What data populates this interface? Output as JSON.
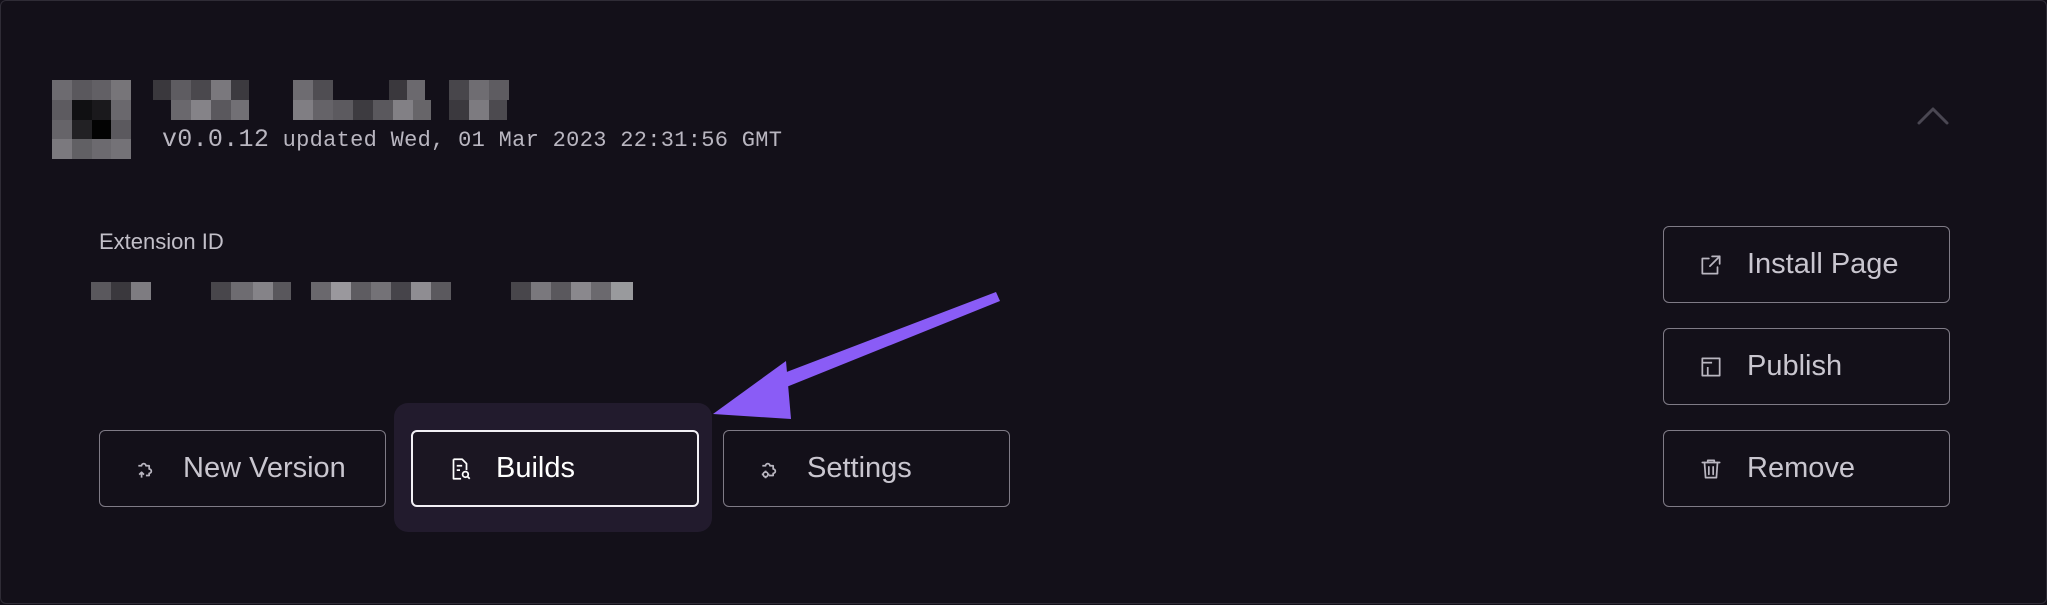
{
  "extension": {
    "version": "v0.0.12",
    "updated": "updated Wed, 01 Mar 2023 22:31:56 GMT",
    "id_label": "Extension ID"
  },
  "actions": {
    "new_version": "New Version",
    "builds": "Builds",
    "settings": "Settings",
    "install_page": "Install Page",
    "publish": "Publish",
    "remove": "Remove"
  },
  "icons": {
    "new_version": "puzzle-upload-icon",
    "builds": "document-search-icon",
    "settings": "puzzle-gear-icon",
    "install_page": "external-link-icon",
    "publish": "publish-icon",
    "remove": "trash-icon",
    "collapse": "chevron-up-icon",
    "annotation": "arrow-annotation"
  },
  "colors": {
    "background": "#131019",
    "accent": "#8a5cf6",
    "text": "#c9c6cf",
    "border": "#7f7b86"
  }
}
